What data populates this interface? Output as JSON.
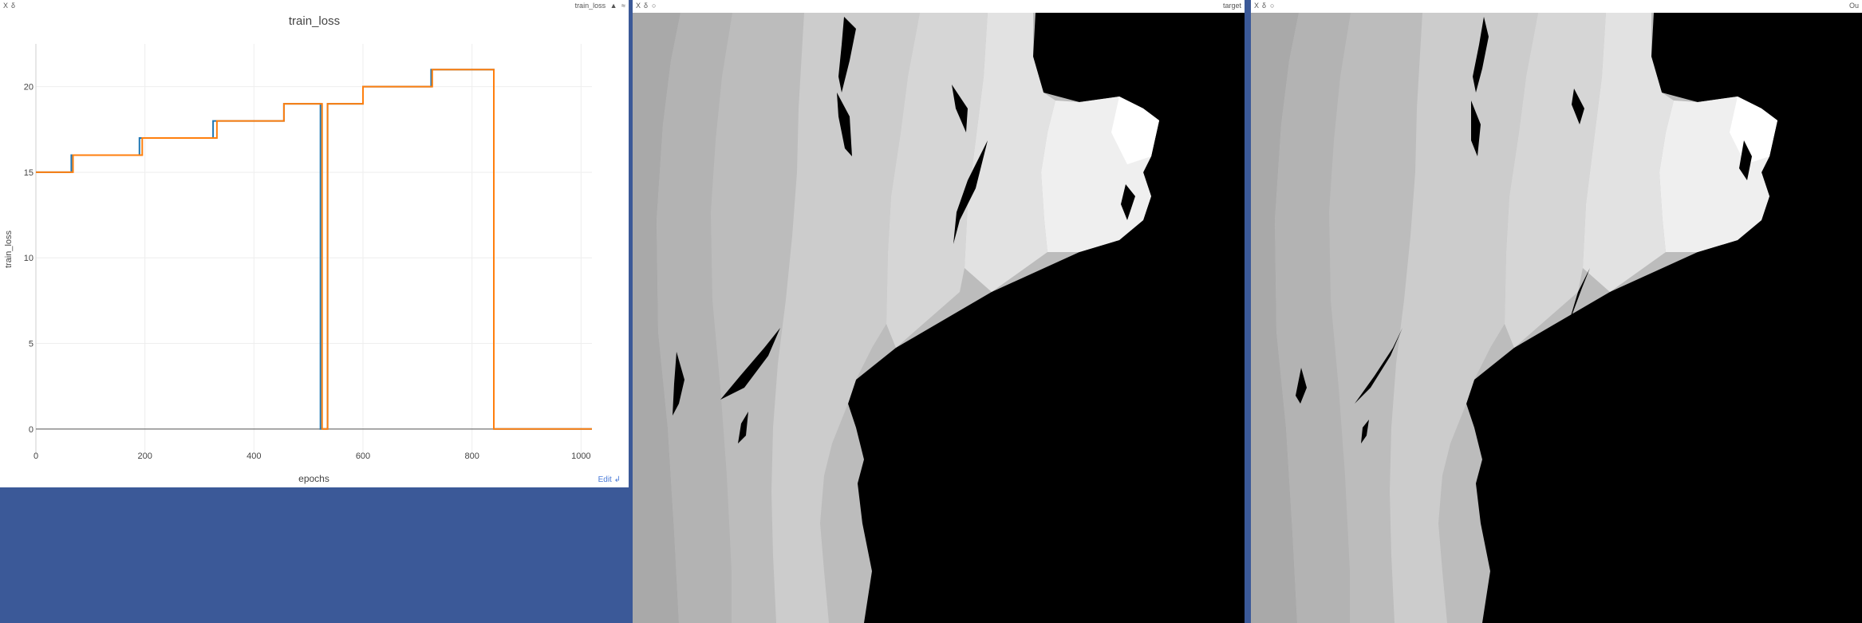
{
  "chart_pane": {
    "close_glyph": "X",
    "info_glyph": "δ",
    "window_title": "train_loss",
    "edit_label": "Edit",
    "edit_glyph": "↲"
  },
  "target_pane": {
    "close_glyph": "X",
    "info_glyph": "δ",
    "save_glyph": "○",
    "window_title": "target"
  },
  "pred_pane": {
    "close_glyph": "X",
    "info_glyph": "δ",
    "save_glyph": "○",
    "window_title": "Ou"
  },
  "chart_data": {
    "type": "line",
    "title": "train_loss",
    "xlabel": "epochs",
    "ylabel": "train_loss",
    "xlim": [
      0,
      1020
    ],
    "ylim": [
      -1.5,
      22.5
    ],
    "xticks": [
      0,
      200,
      400,
      600,
      800,
      1000
    ],
    "yticks": [
      0,
      5,
      10,
      15,
      20
    ],
    "grid": true,
    "colors": [
      "#1f77b4",
      "#ff7f0e"
    ],
    "series": [
      {
        "x": [
          0,
          65,
          65,
          190,
          190,
          325,
          325,
          455,
          455,
          522,
          522,
          535,
          535,
          600,
          600,
          725,
          725,
          840,
          840,
          1020
        ],
        "y": [
          15,
          15,
          16,
          16,
          17,
          17,
          18,
          18,
          19,
          19,
          0,
          0,
          19,
          19,
          20,
          20,
          21,
          21,
          0,
          0
        ]
      },
      {
        "x": [
          0,
          68,
          68,
          195,
          195,
          332,
          332,
          455,
          455,
          525,
          525,
          535,
          535,
          600,
          600,
          727,
          727,
          840,
          840,
          1020
        ],
        "y": [
          15,
          15,
          16,
          16,
          17,
          17,
          18,
          18,
          19,
          19,
          0,
          0,
          19,
          19,
          20,
          20,
          21,
          21,
          0,
          0
        ]
      }
    ]
  }
}
